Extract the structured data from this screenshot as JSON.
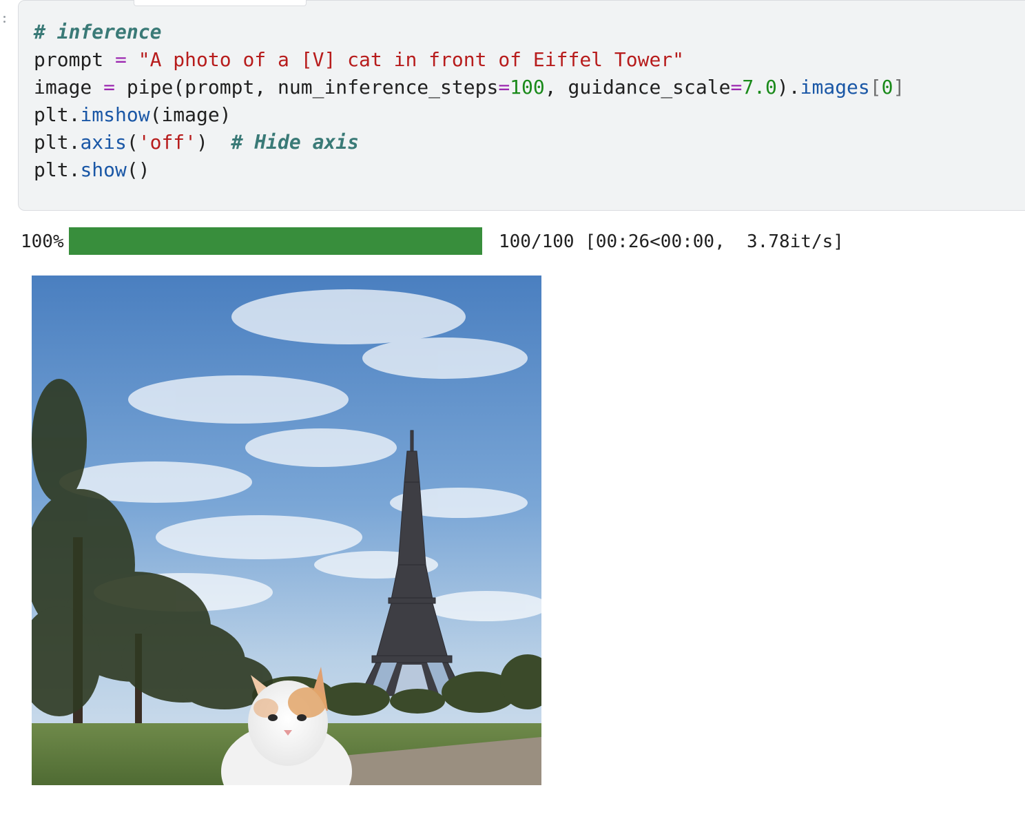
{
  "cell": {
    "code_lines": [
      [
        {
          "t": "# inference",
          "c": "comment"
        }
      ],
      [
        {
          "t": "prompt ",
          "c": ""
        },
        {
          "t": "=",
          "c": "op"
        },
        {
          "t": " ",
          "c": ""
        },
        {
          "t": "\"A photo of a [V] cat in front of Eiffel Tower\"",
          "c": "str"
        }
      ],
      [
        {
          "t": "image ",
          "c": ""
        },
        {
          "t": "=",
          "c": "op"
        },
        {
          "t": " pipe(prompt, num_inference_steps",
          "c": ""
        },
        {
          "t": "=",
          "c": "op"
        },
        {
          "t": "100",
          "c": "num"
        },
        {
          "t": ", guidance_scale",
          "c": ""
        },
        {
          "t": "=",
          "c": "op"
        },
        {
          "t": "7.0",
          "c": "num"
        },
        {
          "t": ").",
          "c": ""
        },
        {
          "t": "images",
          "c": "func"
        },
        {
          "t": "[",
          "c": "bracket"
        },
        {
          "t": "0",
          "c": "num"
        },
        {
          "t": "]",
          "c": "bracket"
        }
      ],
      [
        {
          "t": "plt.",
          "c": ""
        },
        {
          "t": "imshow",
          "c": "func"
        },
        {
          "t": "(image)",
          "c": ""
        }
      ],
      [
        {
          "t": "plt.",
          "c": ""
        },
        {
          "t": "axis",
          "c": "func"
        },
        {
          "t": "(",
          "c": ""
        },
        {
          "t": "'off'",
          "c": "str"
        },
        {
          "t": ")  ",
          "c": ""
        },
        {
          "t": "# Hide axis",
          "c": "comment"
        }
      ],
      [
        {
          "t": "plt.",
          "c": ""
        },
        {
          "t": "show",
          "c": "func"
        },
        {
          "t": "()",
          "c": ""
        }
      ]
    ]
  },
  "output": {
    "progress": {
      "percent_label": "100%",
      "fraction": 1.0,
      "status": "100/100 [00:26<00:00,  3.78it/s]"
    },
    "image": {
      "subject": "generated image: cat in front of Eiffel Tower"
    }
  },
  "colors": {
    "progress_fill": "#388e3c",
    "cell_background": "#f1f3f4",
    "comment": "#3a7a77",
    "string": "#b71c1c",
    "number": "#1a8a1a",
    "operator": "#9c27b0",
    "attribute": "#1a57a6"
  }
}
